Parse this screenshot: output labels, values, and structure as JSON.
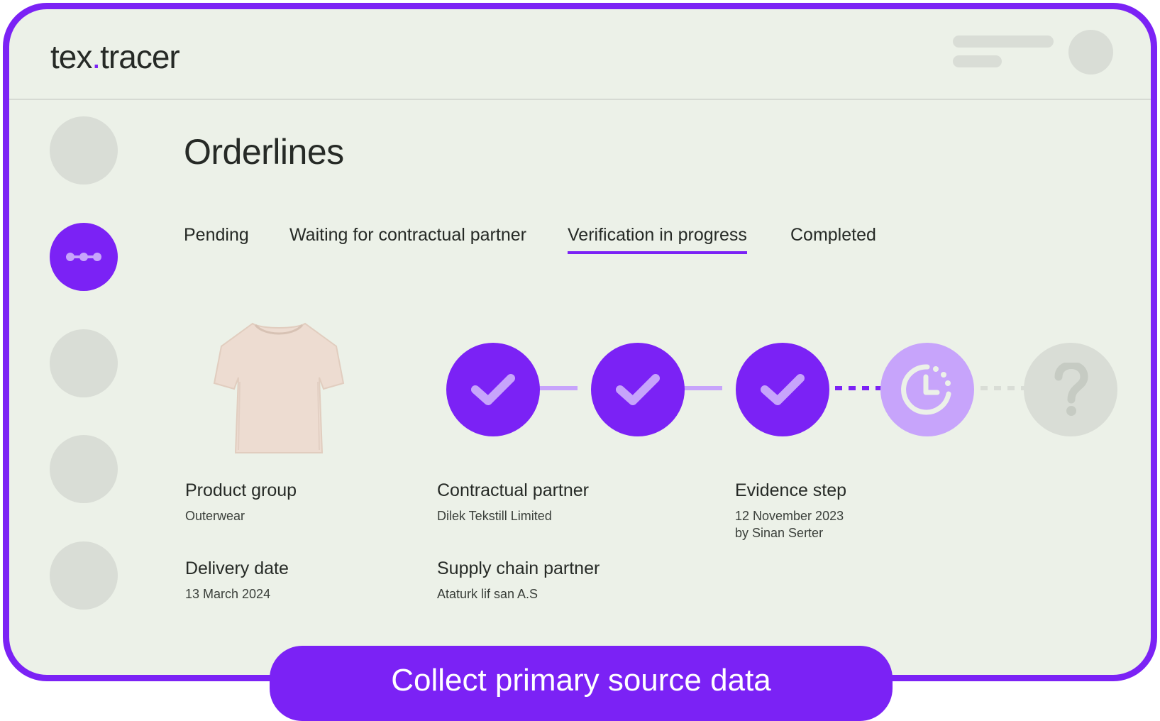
{
  "app": {
    "logo_prefix": "tex",
    "logo_dot": ".",
    "logo_suffix": "tracer"
  },
  "page": {
    "title": "Orderlines"
  },
  "tabs": [
    {
      "label": "Pending",
      "active": false
    },
    {
      "label": "Waiting for contractual partner",
      "active": false
    },
    {
      "label": "Verification in progress",
      "active": true
    },
    {
      "label": "Completed",
      "active": false
    }
  ],
  "progress": {
    "steps": [
      {
        "state": "done",
        "icon": "check-icon"
      },
      {
        "state": "done",
        "icon": "check-icon"
      },
      {
        "state": "done",
        "icon": "check-icon"
      },
      {
        "state": "in-progress",
        "icon": "clock-icon"
      },
      {
        "state": "unknown",
        "icon": "question-icon"
      }
    ]
  },
  "details": {
    "product_group": {
      "label": "Product group",
      "value": "Outerwear"
    },
    "delivery_date": {
      "label": "Delivery date",
      "value": "13 March 2024"
    },
    "contractual_partner": {
      "label": "Contractual partner",
      "value": "Dilek Tekstill Limited"
    },
    "supply_chain_partner": {
      "label": "Supply chain partner",
      "value": "Ataturk lif san A.S"
    },
    "evidence_step": {
      "label": "Evidence step",
      "date": "12 November 2023",
      "by": "by Sinan Serter"
    }
  },
  "cta": {
    "label": "Collect primary source data"
  },
  "colors": {
    "accent": "#7b22f5",
    "accent_light": "#c7a4fb",
    "background": "#ecf1e8",
    "placeholder": "#d9ddd6"
  }
}
